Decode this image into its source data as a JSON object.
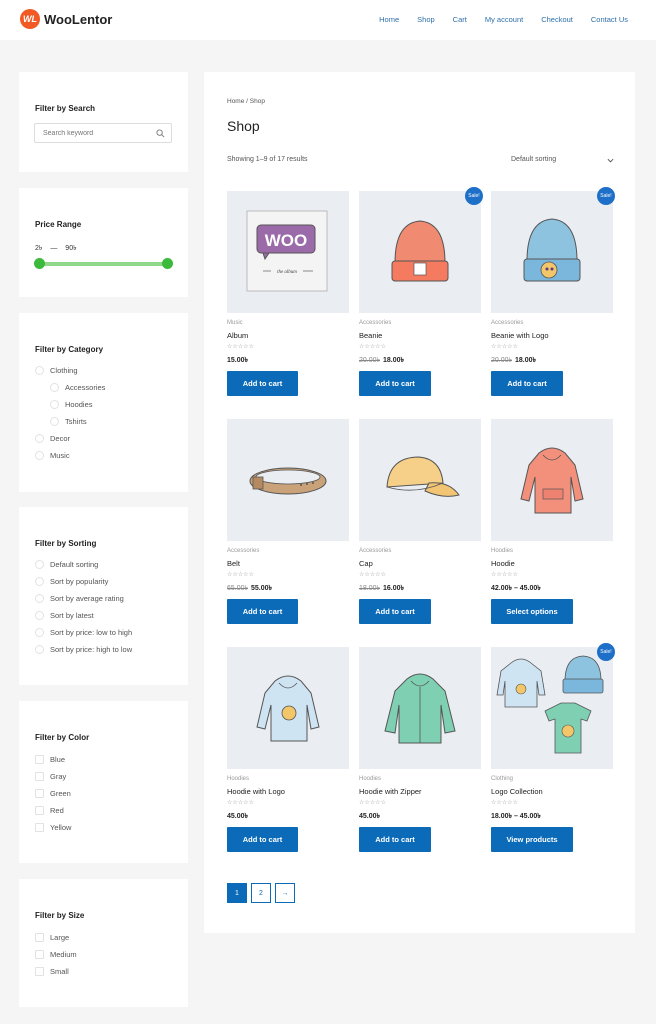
{
  "header": {
    "logo_mark": "WL",
    "logo_text": "WooLentor",
    "nav": [
      "Home",
      "Shop",
      "Cart",
      "My account",
      "Checkout",
      "Contact Us"
    ]
  },
  "sidebar": {
    "search": {
      "title": "Filter by Search",
      "placeholder": "Search keyword"
    },
    "price": {
      "title": "Price Range",
      "min": "2৳",
      "sep": "—",
      "max": "90৳",
      "low": 2,
      "high": 90
    },
    "category": {
      "title": "Filter by Category",
      "items": [
        "Clothing",
        "Accessories",
        "Hoodies",
        "Tshirts",
        "Decor",
        "Music"
      ]
    },
    "sorting": {
      "title": "Filter by Sorting",
      "items": [
        "Default sorting",
        "Sort by popularity",
        "Sort by average rating",
        "Sort by latest",
        "Sort by price: low to high",
        "Sort by price: high to low"
      ]
    },
    "color": {
      "title": "Filter by Color",
      "items": [
        "Blue",
        "Gray",
        "Green",
        "Red",
        "Yellow"
      ]
    },
    "size": {
      "title": "Filter by Size",
      "items": [
        "Large",
        "Medium",
        "Small"
      ]
    }
  },
  "main": {
    "breadcrumb": "Home / Shop",
    "title": "Shop",
    "result_count": "Showing 1–9 of 17 results",
    "sort_selected": "Default sorting",
    "stars": "☆☆☆☆☆",
    "sale_badge": "Sale!",
    "products": [
      {
        "category": "Music",
        "name": "Album",
        "old_price": "",
        "price": "15.00৳",
        "button": "Add to cart"
      },
      {
        "category": "Accessories",
        "name": "Beanie",
        "old_price": "20.00৳",
        "price": "18.00৳",
        "button": "Add to cart"
      },
      {
        "category": "Accessories",
        "name": "Beanie with Logo",
        "old_price": "20.00৳",
        "price": "18.00৳",
        "button": "Add to cart"
      },
      {
        "category": "Accessories",
        "name": "Belt",
        "old_price": "65.00৳",
        "price": "55.00৳",
        "button": "Add to cart"
      },
      {
        "category": "Accessories",
        "name": "Cap",
        "old_price": "18.00৳",
        "price": "16.00৳",
        "button": "Add to cart"
      },
      {
        "category": "Hoodies",
        "name": "Hoodie",
        "old_price": "",
        "price": "42.00৳ – 45.00৳",
        "button": "Select options"
      },
      {
        "category": "Hoodies",
        "name": "Hoodie with Logo",
        "old_price": "",
        "price": "45.00৳",
        "button": "Add to cart"
      },
      {
        "category": "Hoodies",
        "name": "Hoodie with Zipper",
        "old_price": "",
        "price": "45.00৳",
        "button": "Add to cart"
      },
      {
        "category": "Clothing",
        "name": "Logo Collection",
        "old_price": "",
        "price": "18.00৳ – 45.00৳",
        "button": "View products"
      }
    ],
    "image_text": {
      "album_logo": "WOO",
      "album_sub": "the album"
    },
    "pagination": [
      "1",
      "2",
      "→"
    ]
  }
}
